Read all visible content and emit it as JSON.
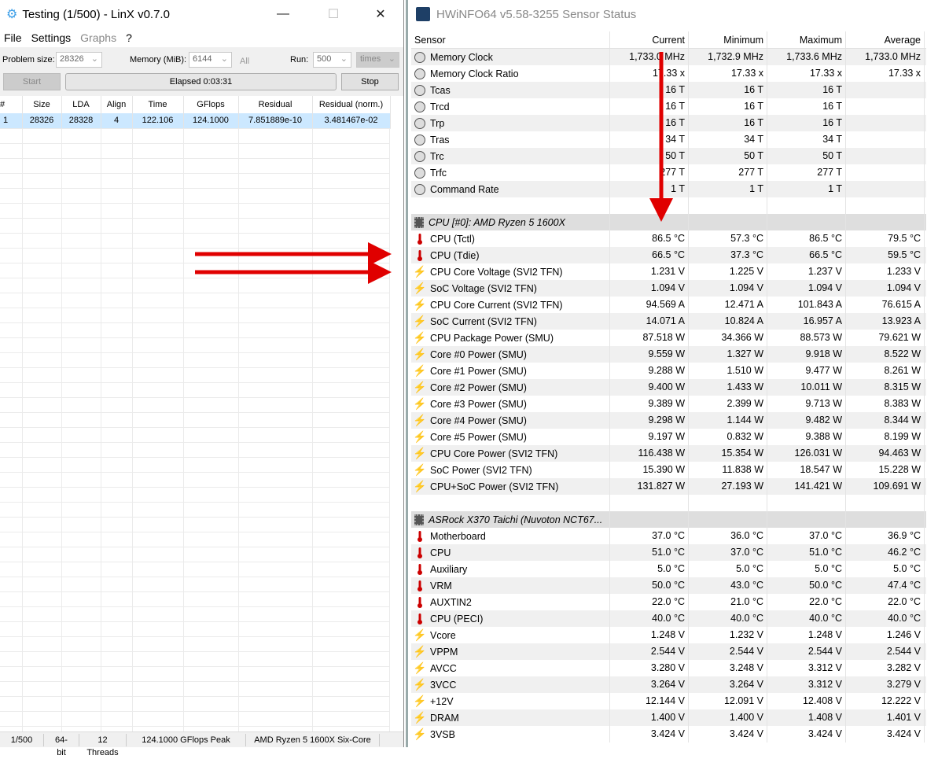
{
  "linx": {
    "title": "Testing (1/500) - LinX v0.7.0",
    "menu": [
      "File",
      "Settings",
      "Graphs",
      "?"
    ],
    "problem_size_label": "Problem size:",
    "problem_size": "28326",
    "memory_label": "Memory (MiB):",
    "memory": "6144",
    "all_label": "All",
    "run_label": "Run:",
    "run": "500",
    "run_unit": "times",
    "start": "Start",
    "elapsed": "Elapsed 0:03:31",
    "stop": "Stop",
    "columns": [
      "#",
      "Size",
      "LDA",
      "Align",
      "Time",
      "GFlops",
      "Residual",
      "Residual (norm.)"
    ],
    "rows": [
      [
        "1",
        "28326",
        "28328",
        "4",
        "122.106",
        "124.1000",
        "7.851889e-10",
        "3.481467e-02"
      ]
    ],
    "status": [
      "1/500",
      "64-bit",
      "12 Threads",
      "124.1000 GFlops Peak",
      "AMD Ryzen 5 1600X Six-Core"
    ]
  },
  "hwinfo": {
    "title": "HWiNFO64 v5.58-3255 Sensor Status",
    "columns": [
      "Sensor",
      "Current",
      "Minimum",
      "Maximum",
      "Average"
    ],
    "rows": [
      {
        "i": "clock",
        "n": "Memory Clock",
        "v": [
          "1,733.0 MHz",
          "1,732.9 MHz",
          "1,733.6 MHz",
          "1,733.0 MHz"
        ]
      },
      {
        "i": "clock",
        "n": "Memory Clock Ratio",
        "v": [
          "17.33 x",
          "17.33 x",
          "17.33 x",
          "17.33 x"
        ]
      },
      {
        "i": "clock",
        "n": "Tcas",
        "v": [
          "16 T",
          "16 T",
          "16 T",
          ""
        ]
      },
      {
        "i": "clock",
        "n": "Trcd",
        "v": [
          "16 T",
          "16 T",
          "16 T",
          ""
        ]
      },
      {
        "i": "clock",
        "n": "Trp",
        "v": [
          "16 T",
          "16 T",
          "16 T",
          ""
        ]
      },
      {
        "i": "clock",
        "n": "Tras",
        "v": [
          "34 T",
          "34 T",
          "34 T",
          ""
        ]
      },
      {
        "i": "clock",
        "n": "Trc",
        "v": [
          "50 T",
          "50 T",
          "50 T",
          ""
        ]
      },
      {
        "i": "clock",
        "n": "Trfc",
        "v": [
          "277 T",
          "277 T",
          "277 T",
          ""
        ]
      },
      {
        "i": "clock",
        "n": "Command Rate",
        "v": [
          "1 T",
          "1 T",
          "1 T",
          ""
        ]
      },
      {
        "i": "",
        "n": "",
        "v": [
          "",
          "",
          "",
          ""
        ]
      },
      {
        "i": "chip",
        "n": "CPU [#0]: AMD Ryzen 5 1600X",
        "g": true,
        "v": [
          "",
          "",
          "",
          ""
        ]
      },
      {
        "i": "therm",
        "n": "CPU (Tctl)",
        "v": [
          "86.5 °C",
          "57.3 °C",
          "86.5 °C",
          "79.5 °C"
        ]
      },
      {
        "i": "therm",
        "n": "CPU (Tdie)",
        "v": [
          "66.5 °C",
          "37.3 °C",
          "66.5 °C",
          "59.5 °C"
        ]
      },
      {
        "i": "volt",
        "n": "CPU Core Voltage (SVI2 TFN)",
        "v": [
          "1.231 V",
          "1.225 V",
          "1.237 V",
          "1.233 V"
        ]
      },
      {
        "i": "volt",
        "n": "SoC Voltage (SVI2 TFN)",
        "v": [
          "1.094 V",
          "1.094 V",
          "1.094 V",
          "1.094 V"
        ]
      },
      {
        "i": "volt",
        "n": "CPU Core Current (SVI2 TFN)",
        "v": [
          "94.569 A",
          "12.471 A",
          "101.843 A",
          "76.615 A"
        ]
      },
      {
        "i": "volt",
        "n": "SoC Current (SVI2 TFN)",
        "v": [
          "14.071 A",
          "10.824 A",
          "16.957 A",
          "13.923 A"
        ]
      },
      {
        "i": "volt",
        "n": "CPU Package Power (SMU)",
        "v": [
          "87.518 W",
          "34.366 W",
          "88.573 W",
          "79.621 W"
        ]
      },
      {
        "i": "volt",
        "n": "Core #0 Power (SMU)",
        "v": [
          "9.559 W",
          "1.327 W",
          "9.918 W",
          "8.522 W"
        ]
      },
      {
        "i": "volt",
        "n": "Core #1 Power (SMU)",
        "v": [
          "9.288 W",
          "1.510 W",
          "9.477 W",
          "8.261 W"
        ]
      },
      {
        "i": "volt",
        "n": "Core #2 Power (SMU)",
        "v": [
          "9.400 W",
          "1.433 W",
          "10.011 W",
          "8.315 W"
        ]
      },
      {
        "i": "volt",
        "n": "Core #3 Power (SMU)",
        "v": [
          "9.389 W",
          "2.399 W",
          "9.713 W",
          "8.383 W"
        ]
      },
      {
        "i": "volt",
        "n": "Core #4 Power (SMU)",
        "v": [
          "9.298 W",
          "1.144 W",
          "9.482 W",
          "8.344 W"
        ]
      },
      {
        "i": "volt",
        "n": "Core #5 Power (SMU)",
        "v": [
          "9.197 W",
          "0.832 W",
          "9.388 W",
          "8.199 W"
        ]
      },
      {
        "i": "volt",
        "n": "CPU Core Power (SVI2 TFN)",
        "v": [
          "116.438 W",
          "15.354 W",
          "126.031 W",
          "94.463 W"
        ]
      },
      {
        "i": "volt",
        "n": "SoC Power (SVI2 TFN)",
        "v": [
          "15.390 W",
          "11.838 W",
          "18.547 W",
          "15.228 W"
        ]
      },
      {
        "i": "volt",
        "n": "CPU+SoC Power (SVI2 TFN)",
        "v": [
          "131.827 W",
          "27.193 W",
          "141.421 W",
          "109.691 W"
        ]
      },
      {
        "i": "",
        "n": "",
        "v": [
          "",
          "",
          "",
          ""
        ]
      },
      {
        "i": "chip",
        "n": "ASRock X370 Taichi (Nuvoton NCT67...",
        "g": true,
        "v": [
          "",
          "",
          "",
          ""
        ]
      },
      {
        "i": "therm",
        "n": "Motherboard",
        "v": [
          "37.0 °C",
          "36.0 °C",
          "37.0 °C",
          "36.9 °C"
        ]
      },
      {
        "i": "therm",
        "n": "CPU",
        "v": [
          "51.0 °C",
          "37.0 °C",
          "51.0 °C",
          "46.2 °C"
        ]
      },
      {
        "i": "therm",
        "n": "Auxiliary",
        "v": [
          "5.0 °C",
          "5.0 °C",
          "5.0 °C",
          "5.0 °C"
        ]
      },
      {
        "i": "therm",
        "n": "VRM",
        "v": [
          "50.0 °C",
          "43.0 °C",
          "50.0 °C",
          "47.4 °C"
        ]
      },
      {
        "i": "therm",
        "n": "AUXTIN2",
        "v": [
          "22.0 °C",
          "21.0 °C",
          "22.0 °C",
          "22.0 °C"
        ]
      },
      {
        "i": "therm",
        "n": "CPU (PECI)",
        "v": [
          "40.0 °C",
          "40.0 °C",
          "40.0 °C",
          "40.0 °C"
        ]
      },
      {
        "i": "volt",
        "n": "Vcore",
        "v": [
          "1.248 V",
          "1.232 V",
          "1.248 V",
          "1.246 V"
        ]
      },
      {
        "i": "volt",
        "n": "VPPM",
        "v": [
          "2.544 V",
          "2.544 V",
          "2.544 V",
          "2.544 V"
        ]
      },
      {
        "i": "volt",
        "n": "AVCC",
        "v": [
          "3.280 V",
          "3.248 V",
          "3.312 V",
          "3.282 V"
        ]
      },
      {
        "i": "volt",
        "n": "3VCC",
        "v": [
          "3.264 V",
          "3.264 V",
          "3.312 V",
          "3.279 V"
        ]
      },
      {
        "i": "volt",
        "n": "+12V",
        "v": [
          "12.144 V",
          "12.091 V",
          "12.408 V",
          "12.222 V"
        ]
      },
      {
        "i": "volt",
        "n": "DRAM",
        "v": [
          "1.400 V",
          "1.400 V",
          "1.408 V",
          "1.401 V"
        ]
      },
      {
        "i": "volt",
        "n": "3VSB",
        "v": [
          "3.424 V",
          "3.424 V",
          "3.424 V",
          "3.424 V"
        ]
      }
    ]
  },
  "colors": {
    "arrow": "#e00000",
    "selection": "#cce8ff"
  }
}
